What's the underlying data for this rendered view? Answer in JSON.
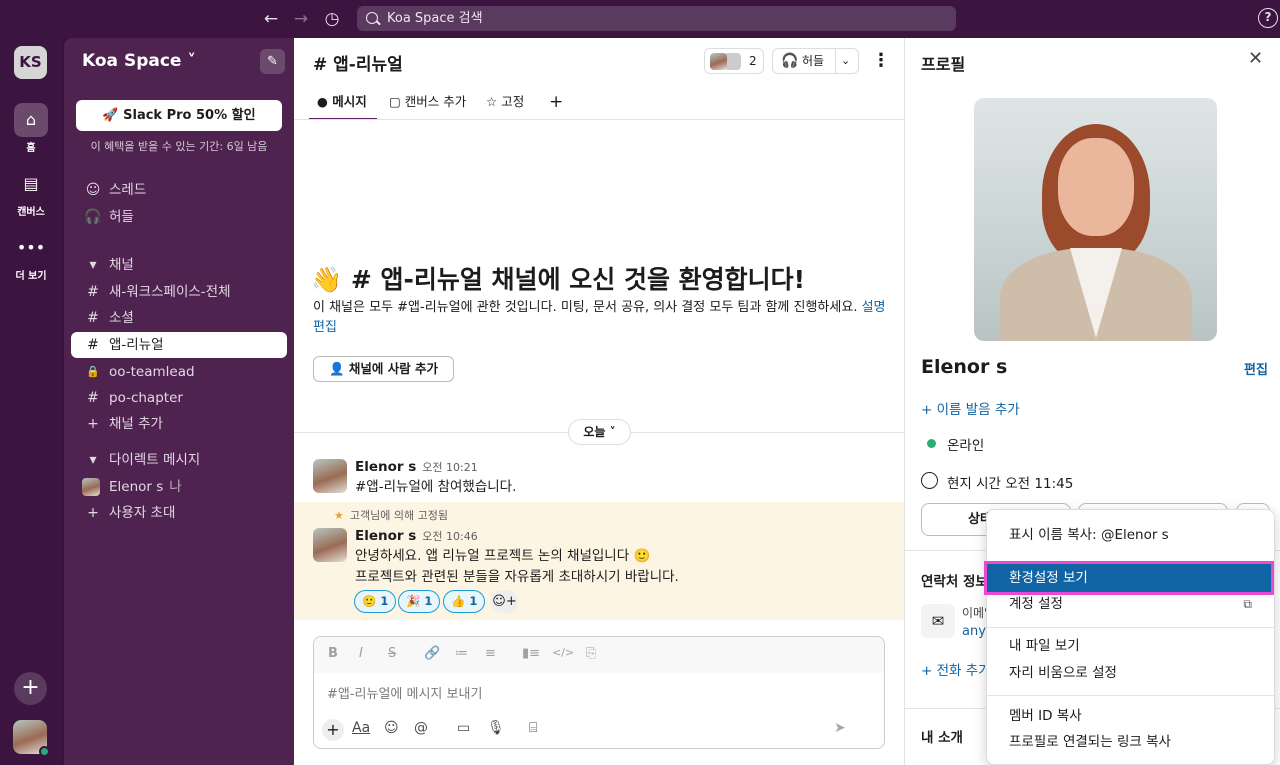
{
  "topbar": {
    "search_placeholder": "Koa Space 검색",
    "back": "←",
    "forward": "→",
    "history": "◷",
    "help": "?"
  },
  "rail": {
    "workspace_initials": "KS",
    "items": [
      {
        "label": "홈",
        "icon": "⌂"
      },
      {
        "label": "캔버스",
        "icon": "▤"
      },
      {
        "label": "더 보기",
        "icon": "•••"
      }
    ],
    "add": "+"
  },
  "sidebar": {
    "workspace_name": "Koa Space ˅",
    "compose_icon": "✎",
    "promo_button": "🚀 Slack Pro 50% 할인",
    "promo_sub": "이 혜택을 받을 수 있는 기간: 6일 남음",
    "top_items": [
      {
        "label": "스레드",
        "icon": "☺"
      },
      {
        "label": "허들",
        "icon": "🎧"
      }
    ],
    "channels_header": "채널",
    "channels": [
      {
        "label": "새-워크스페이스-전체",
        "icon": "#"
      },
      {
        "label": "소셜",
        "icon": "#"
      },
      {
        "label": "앱-리뉴얼",
        "icon": "#"
      },
      {
        "label": "oo-teamlead",
        "icon": "🔒"
      },
      {
        "label": "po-chapter",
        "icon": "#"
      },
      {
        "label": "채널 추가",
        "icon": "+"
      }
    ],
    "dm_header": "다이렉트 메시지",
    "dms": [
      {
        "label": "Elenor s",
        "suffix": "나"
      },
      {
        "label": "사용자 초대",
        "icon": "+"
      }
    ],
    "caret": "▾"
  },
  "channel": {
    "title": "# 앱-리뉴얼",
    "member_count": "2",
    "huddle_label": "허들",
    "huddle_icon": "🎧",
    "huddle_caret": "⌄",
    "more_icon": "⋮",
    "tabs": [
      {
        "label": "메시지",
        "icon": "●"
      },
      {
        "label": "캔버스 추가",
        "icon": "▢"
      },
      {
        "label": "고정",
        "icon": "☆"
      },
      {
        "label": "",
        "icon": "+"
      }
    ],
    "welcome_title": "👋 # 앱-리뉴얼 채널에 오신 것을 환영합니다!",
    "welcome_desc": "이 채널은 모두 #앱-리뉴얼에 관한 것입니다. 미팅, 문서 공유, 의사 결정 모두 팀과 함께 진행하세요. ",
    "welcome_link": "설명 편집",
    "add_people": "👤 채널에 사람 추가",
    "day": "오늘 ˅",
    "messages": [
      {
        "name": "Elenor s",
        "time": "오전 10:21",
        "lines": [
          "#앱-리뉴얼에 참여했습니다."
        ]
      },
      {
        "name": "Elenor s",
        "time": "오전 10:46",
        "lines": [
          "안녕하세요. 앱 리뉴얼 프로젝트 논의 채널입니다 🙂",
          "프로젝트와 관련된 분들을 자유롭게 초대하시기 바랍니다."
        ]
      }
    ],
    "pinned_note": "고객님에 의해 고정됨",
    "reactions": [
      {
        "emoji": "🙂",
        "count": "1"
      },
      {
        "emoji": "🎉",
        "count": "1"
      },
      {
        "emoji": "👍",
        "count": "1"
      }
    ],
    "reaction_add": "☺+",
    "composer": {
      "placeholder": "#앱-리뉴얼에 메시지 보내기",
      "format_icons": [
        "B",
        "I",
        "S̶",
        "🔗",
        "≔",
        "≡",
        "▮≡",
        "</>",
        "⎘"
      ],
      "bottom_icons": [
        "Aa",
        "☺",
        "@",
        "▭",
        "🎙",
        "⌸"
      ],
      "plus": "+",
      "send": "➤"
    }
  },
  "profile": {
    "title": "프로필",
    "close": "✕",
    "name": "Elenor s",
    "edit": "편집",
    "pronunciation": "+ 이름 발음 추가",
    "status": "온라인",
    "local_time": "현지 시간 오전 11:45",
    "buttons": [
      "상태",
      "",
      ""
    ],
    "contact_header": "연락처 정보",
    "email_label": "이메일",
    "email_value": "anyw",
    "mail_icon": "✉",
    "phone_add": "+ 전화 추가",
    "about_header": "내 소개"
  },
  "menu": {
    "items": [
      {
        "label": "표시 이름 복사: @Elenor s"
      },
      {
        "label": "환경설정 보기",
        "highlighted": true
      },
      {
        "label": "계정 설정",
        "external": "⧉"
      },
      {
        "label": "내 파일 보기"
      },
      {
        "label": "자리 비움으로 설정"
      },
      {
        "label": "멤버 ID 복사"
      },
      {
        "label": "프로필로 연결되는 링크 복사"
      }
    ]
  },
  "colors": {
    "accent": "#611f69",
    "link": "#1264a3",
    "highlight": "#1164a3",
    "annotation": "#e84ad3",
    "online": "#2bac76"
  }
}
